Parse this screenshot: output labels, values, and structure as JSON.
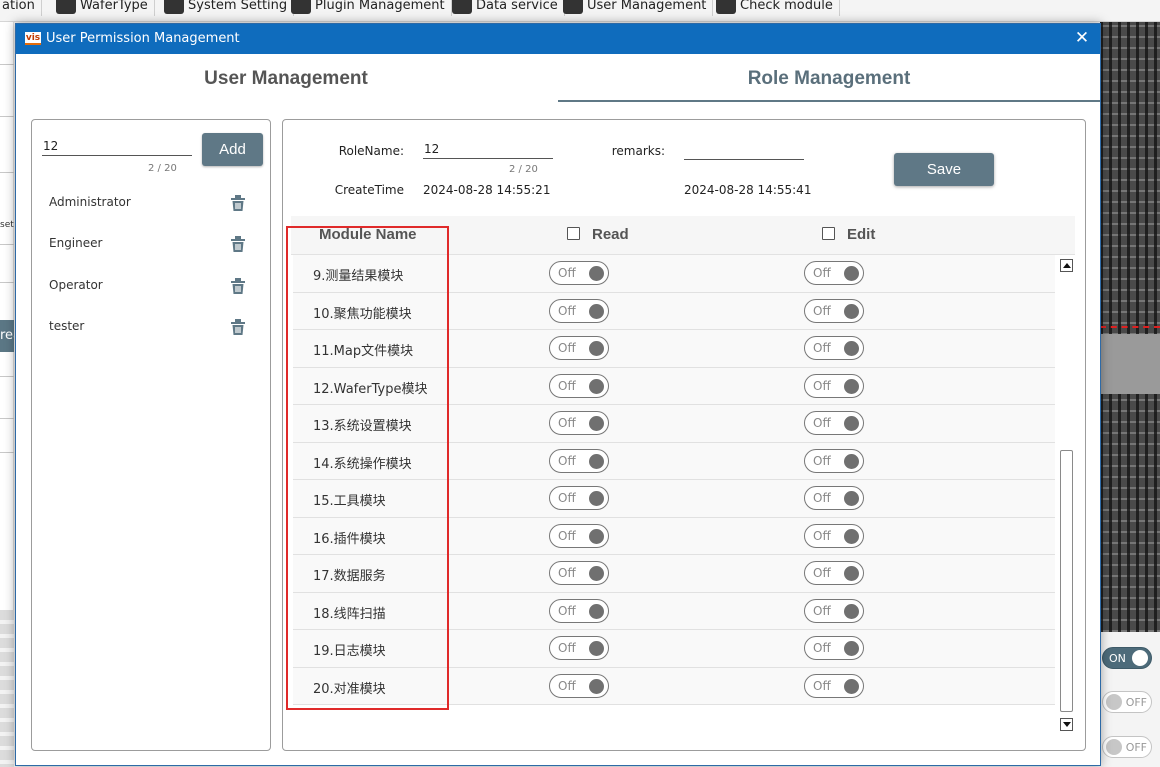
{
  "background": {
    "tabs": [
      {
        "label": "ation"
      },
      {
        "label": "WaferType"
      },
      {
        "label": "System Setting"
      },
      {
        "label": "Plugin Management"
      },
      {
        "label": "Data service"
      },
      {
        "label": "User Management"
      },
      {
        "label": "Check module"
      }
    ],
    "left_setting_text": "set",
    "left_button_text": "rea",
    "toggles": [
      {
        "state": "ON"
      },
      {
        "state": "OFF"
      },
      {
        "state": "OFF"
      }
    ]
  },
  "dialog": {
    "logo_text": "vis",
    "title": "User Permission Management",
    "close_label": "✕",
    "tabs": [
      {
        "label": "User Management"
      },
      {
        "label": "Role Management"
      }
    ],
    "active_tab": "Role Management",
    "users": {
      "search_value": "12",
      "counter": "2 / 20",
      "add_label": "Add",
      "items": [
        {
          "name": "Administrator"
        },
        {
          "name": "Engineer"
        },
        {
          "name": "Operator"
        },
        {
          "name": "tester"
        }
      ]
    },
    "role": {
      "rolename_label": "RoleName:",
      "rolename_value": "12",
      "rolename_counter": "2 / 20",
      "remarks_label": "remarks:",
      "remarks_value": "",
      "createtime_label": "CreateTime",
      "createtime_value": "2024-08-28 14:55:21",
      "second_time_value": "2024-08-28 14:55:41",
      "save_label": "Save"
    },
    "permissions": {
      "headers": {
        "module": "Module Name",
        "read": "Read",
        "edit": "Edit"
      },
      "rows": [
        {
          "module": "9.测量结果模块",
          "read": "Off",
          "edit": "Off"
        },
        {
          "module": "10.聚焦功能模块",
          "read": "Off",
          "edit": "Off"
        },
        {
          "module": "11.Map文件模块",
          "read": "Off",
          "edit": "Off"
        },
        {
          "module": "12.WaferType模块",
          "read": "Off",
          "edit": "Off"
        },
        {
          "module": "13.系统设置模块",
          "read": "Off",
          "edit": "Off"
        },
        {
          "module": "14.系统操作模块",
          "read": "Off",
          "edit": "Off"
        },
        {
          "module": "15.工具模块",
          "read": "Off",
          "edit": "Off"
        },
        {
          "module": "16.插件模块",
          "read": "Off",
          "edit": "Off"
        },
        {
          "module": "17.数据服务",
          "read": "Off",
          "edit": "Off"
        },
        {
          "module": "18.线阵扫描",
          "read": "Off",
          "edit": "Off"
        },
        {
          "module": "19.日志模块",
          "read": "Off",
          "edit": "Off"
        },
        {
          "module": "20.对准模块",
          "read": "Off",
          "edit": "Off"
        }
      ]
    }
  },
  "colors": {
    "titlebar": "#0f6cbd",
    "accent": "#5f7886",
    "highlight": "#e02a2a"
  }
}
